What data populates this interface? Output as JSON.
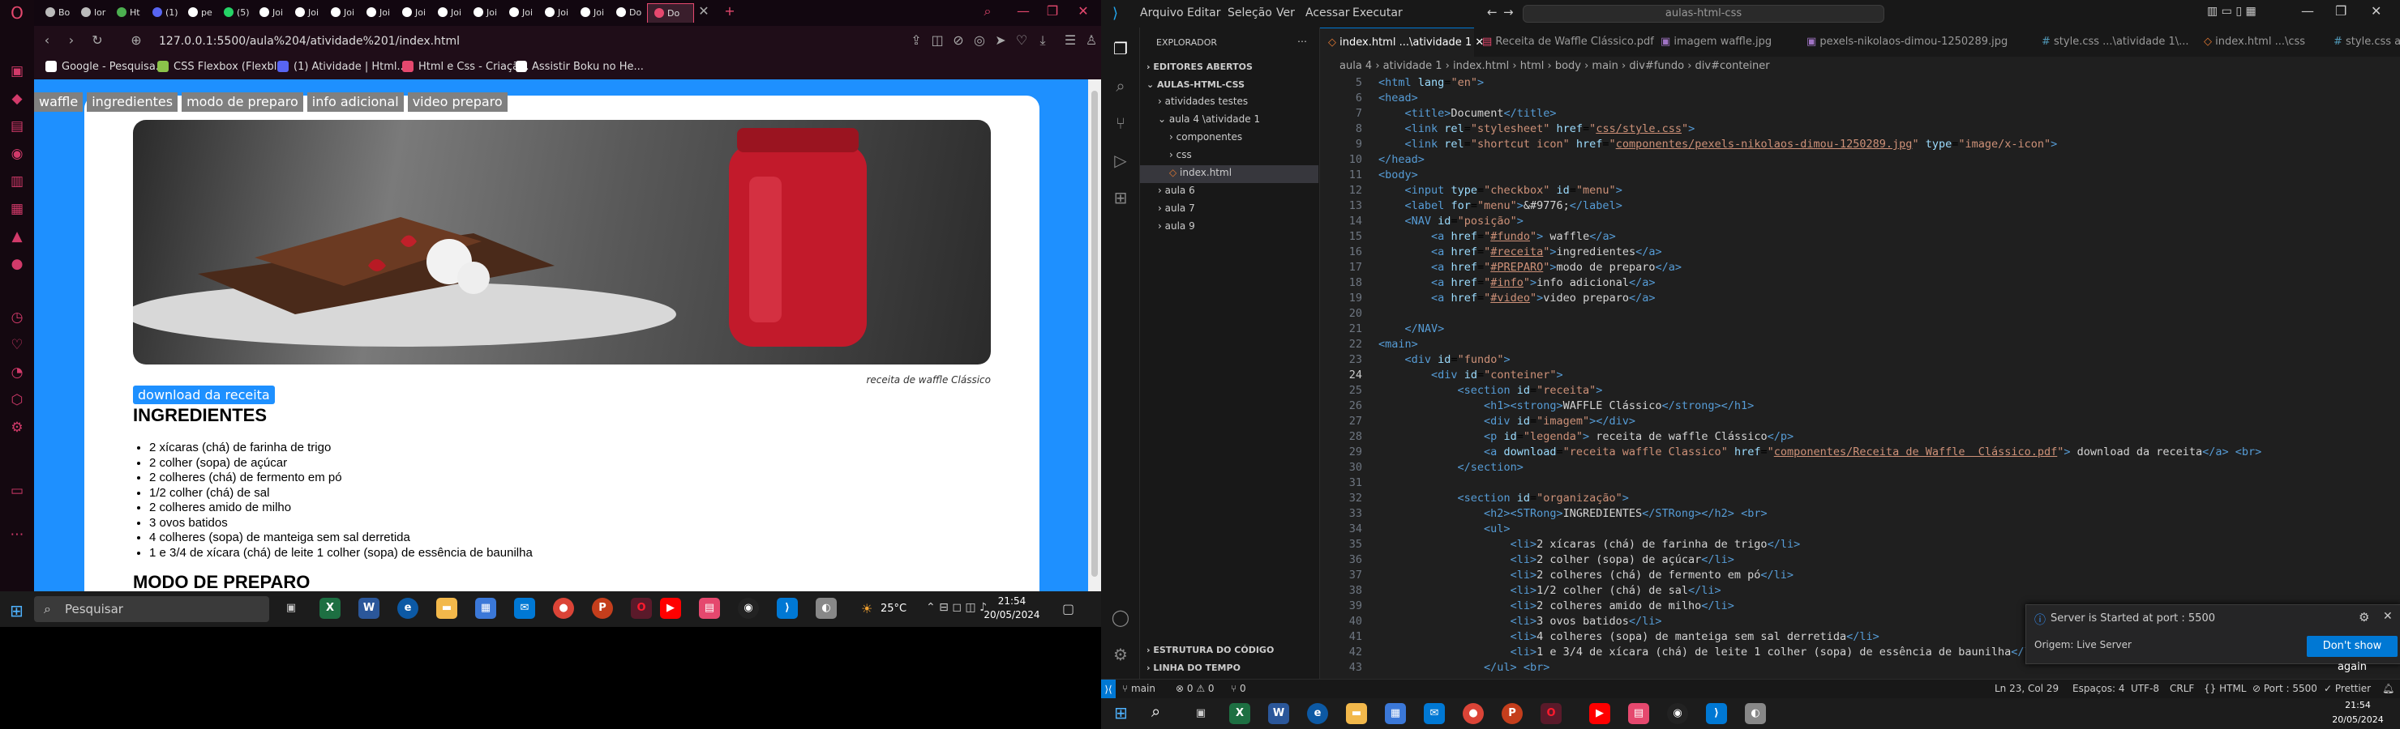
{
  "browser": {
    "tabs": [
      "Bo",
      "lor",
      "Ht",
      "(1)",
      "pe",
      "(5)",
      "Joi",
      "Joi",
      "Joi",
      "Joi",
      "Joi",
      "Joi",
      "Joi",
      "Joi",
      "Joi",
      "Joi",
      "Do",
      "Do"
    ],
    "url": "127.0.0.1:5500/aula%204/atividade%201/index.html",
    "bookmarks": [
      "Google - Pesquisa...",
      "CSS Flexbox (Flexbl...",
      "(1) Atividade | Html...",
      "Html e Css - Criaçã...",
      "Assistir Boku no He..."
    ]
  },
  "page": {
    "nav": [
      "waffle",
      "ingredientes",
      "modo de preparo",
      "info adicional",
      "video preparo"
    ],
    "legend": "receita de waffle Clássico",
    "download": "download da receita",
    "ingredients_title": "INGREDIENTES",
    "ingredients": [
      "2 xícaras (chá) de farinha de trigo",
      "2 colher (sopa) de açúcar",
      "2 colheres (chá) de fermento em pó",
      "1/2 colher (chá) de sal",
      "2 colheres amido de milho",
      "3 ovos batidos",
      "4 colheres (sopa) de manteiga sem sal derretida",
      "1 e 3/4 de xícara (chá) de leite 1 colher (sopa) de essência de baunilha"
    ],
    "prep_title": "MODO DE PREPARO"
  },
  "taskbar1": {
    "search": "Pesquisar",
    "temp": "25°C",
    "time": "21:54",
    "date": "20/05/2024"
  },
  "vscode": {
    "menus": [
      "Arquivo",
      "Editar",
      "Seleção",
      "Ver",
      "Acessar",
      "Executar"
    ],
    "search": "aulas-html-css",
    "explorer": "EXPLORADOR",
    "open_editors": "EDITORES ABERTOS",
    "workspace": "AULAS-HTML-CSS",
    "tree": [
      "atividades testes",
      "aula 4 \\atividade 1",
      "componentes",
      "css",
      "index.html",
      "aula 6",
      "aula 7",
      "aula 9"
    ],
    "outline": "ESTRUTURA DO CÓDIGO",
    "timeline": "LINHA DO TEMPO",
    "tabs": [
      "index.html ...\\atividade 1",
      "Receita de Waffle Clássico.pdf",
      "imagem waffle.jpg",
      "pexels-nikolaos-dimou-1250289.jpg",
      "style.css ...\\atividade 1\\...",
      "index.html ...\\css",
      "style.css ativ"
    ],
    "breadcrumbs": "aula 4 › atividade 1 › index.html › html › body › main › div#fundo › div#conteiner",
    "notif_title": "Server is Started at port : 5500",
    "notif_source": "Origem: Live Server",
    "notif_button": "Don't show again",
    "status": {
      "branch": "main",
      "errors": "⊗ 0 ⚠ 0",
      "ports": "⑂ 0",
      "pos": "Ln 23, Col 29",
      "spaces": "Espaços: 4",
      "enc": "UTF-8",
      "eol": "CRLF",
      "lang": "{} HTML",
      "port": "⊘ Port : 5500",
      "prettier": "✓ Prettier"
    }
  },
  "taskbar2": {
    "time": "21:54",
    "date": "20/05/2024"
  }
}
